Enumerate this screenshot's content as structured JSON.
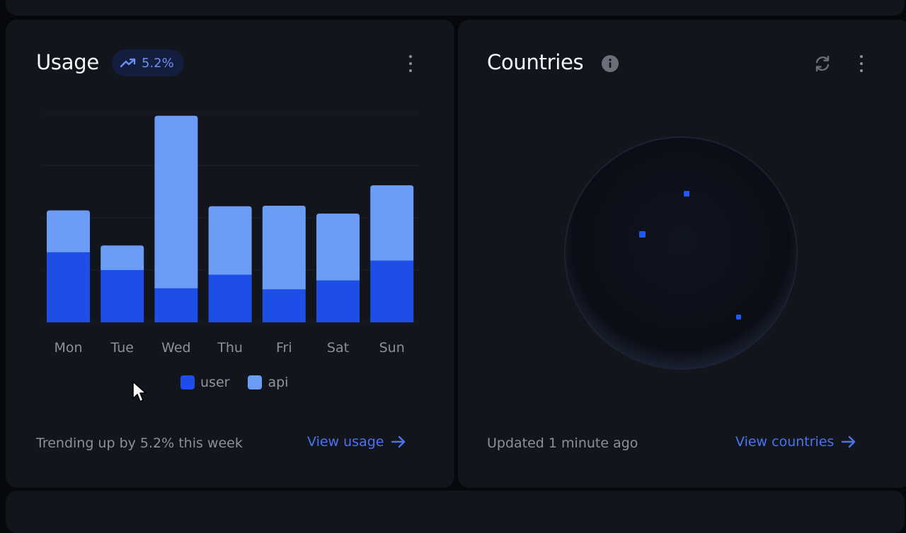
{
  "usage": {
    "title": "Usage",
    "trend_badge": "5.2%",
    "footer": "Trending up by 5.2% this week",
    "link": "View usage",
    "legend": [
      {
        "label": "user",
        "color": "#1d4ee8"
      },
      {
        "label": "api",
        "color": "#6b9df7"
      }
    ]
  },
  "countries": {
    "title": "Countries",
    "footer": "Updated 1 minute ago",
    "link": "View countries"
  },
  "chart_data": {
    "type": "bar",
    "stacked": true,
    "categories": [
      "Mon",
      "Tue",
      "Wed",
      "Thu",
      "Fri",
      "Sat",
      "Sun"
    ],
    "series": [
      {
        "name": "user",
        "color": "#1d4ee8",
        "values": [
          134,
          100,
          65,
          91,
          63,
          80,
          118
        ]
      },
      {
        "name": "api",
        "color": "#6b9df7",
        "values": [
          80,
          47,
          330,
          131,
          160,
          128,
          144
        ]
      }
    ],
    "ylim": [
      0,
      400
    ],
    "grid": true,
    "legend": "bottom"
  }
}
